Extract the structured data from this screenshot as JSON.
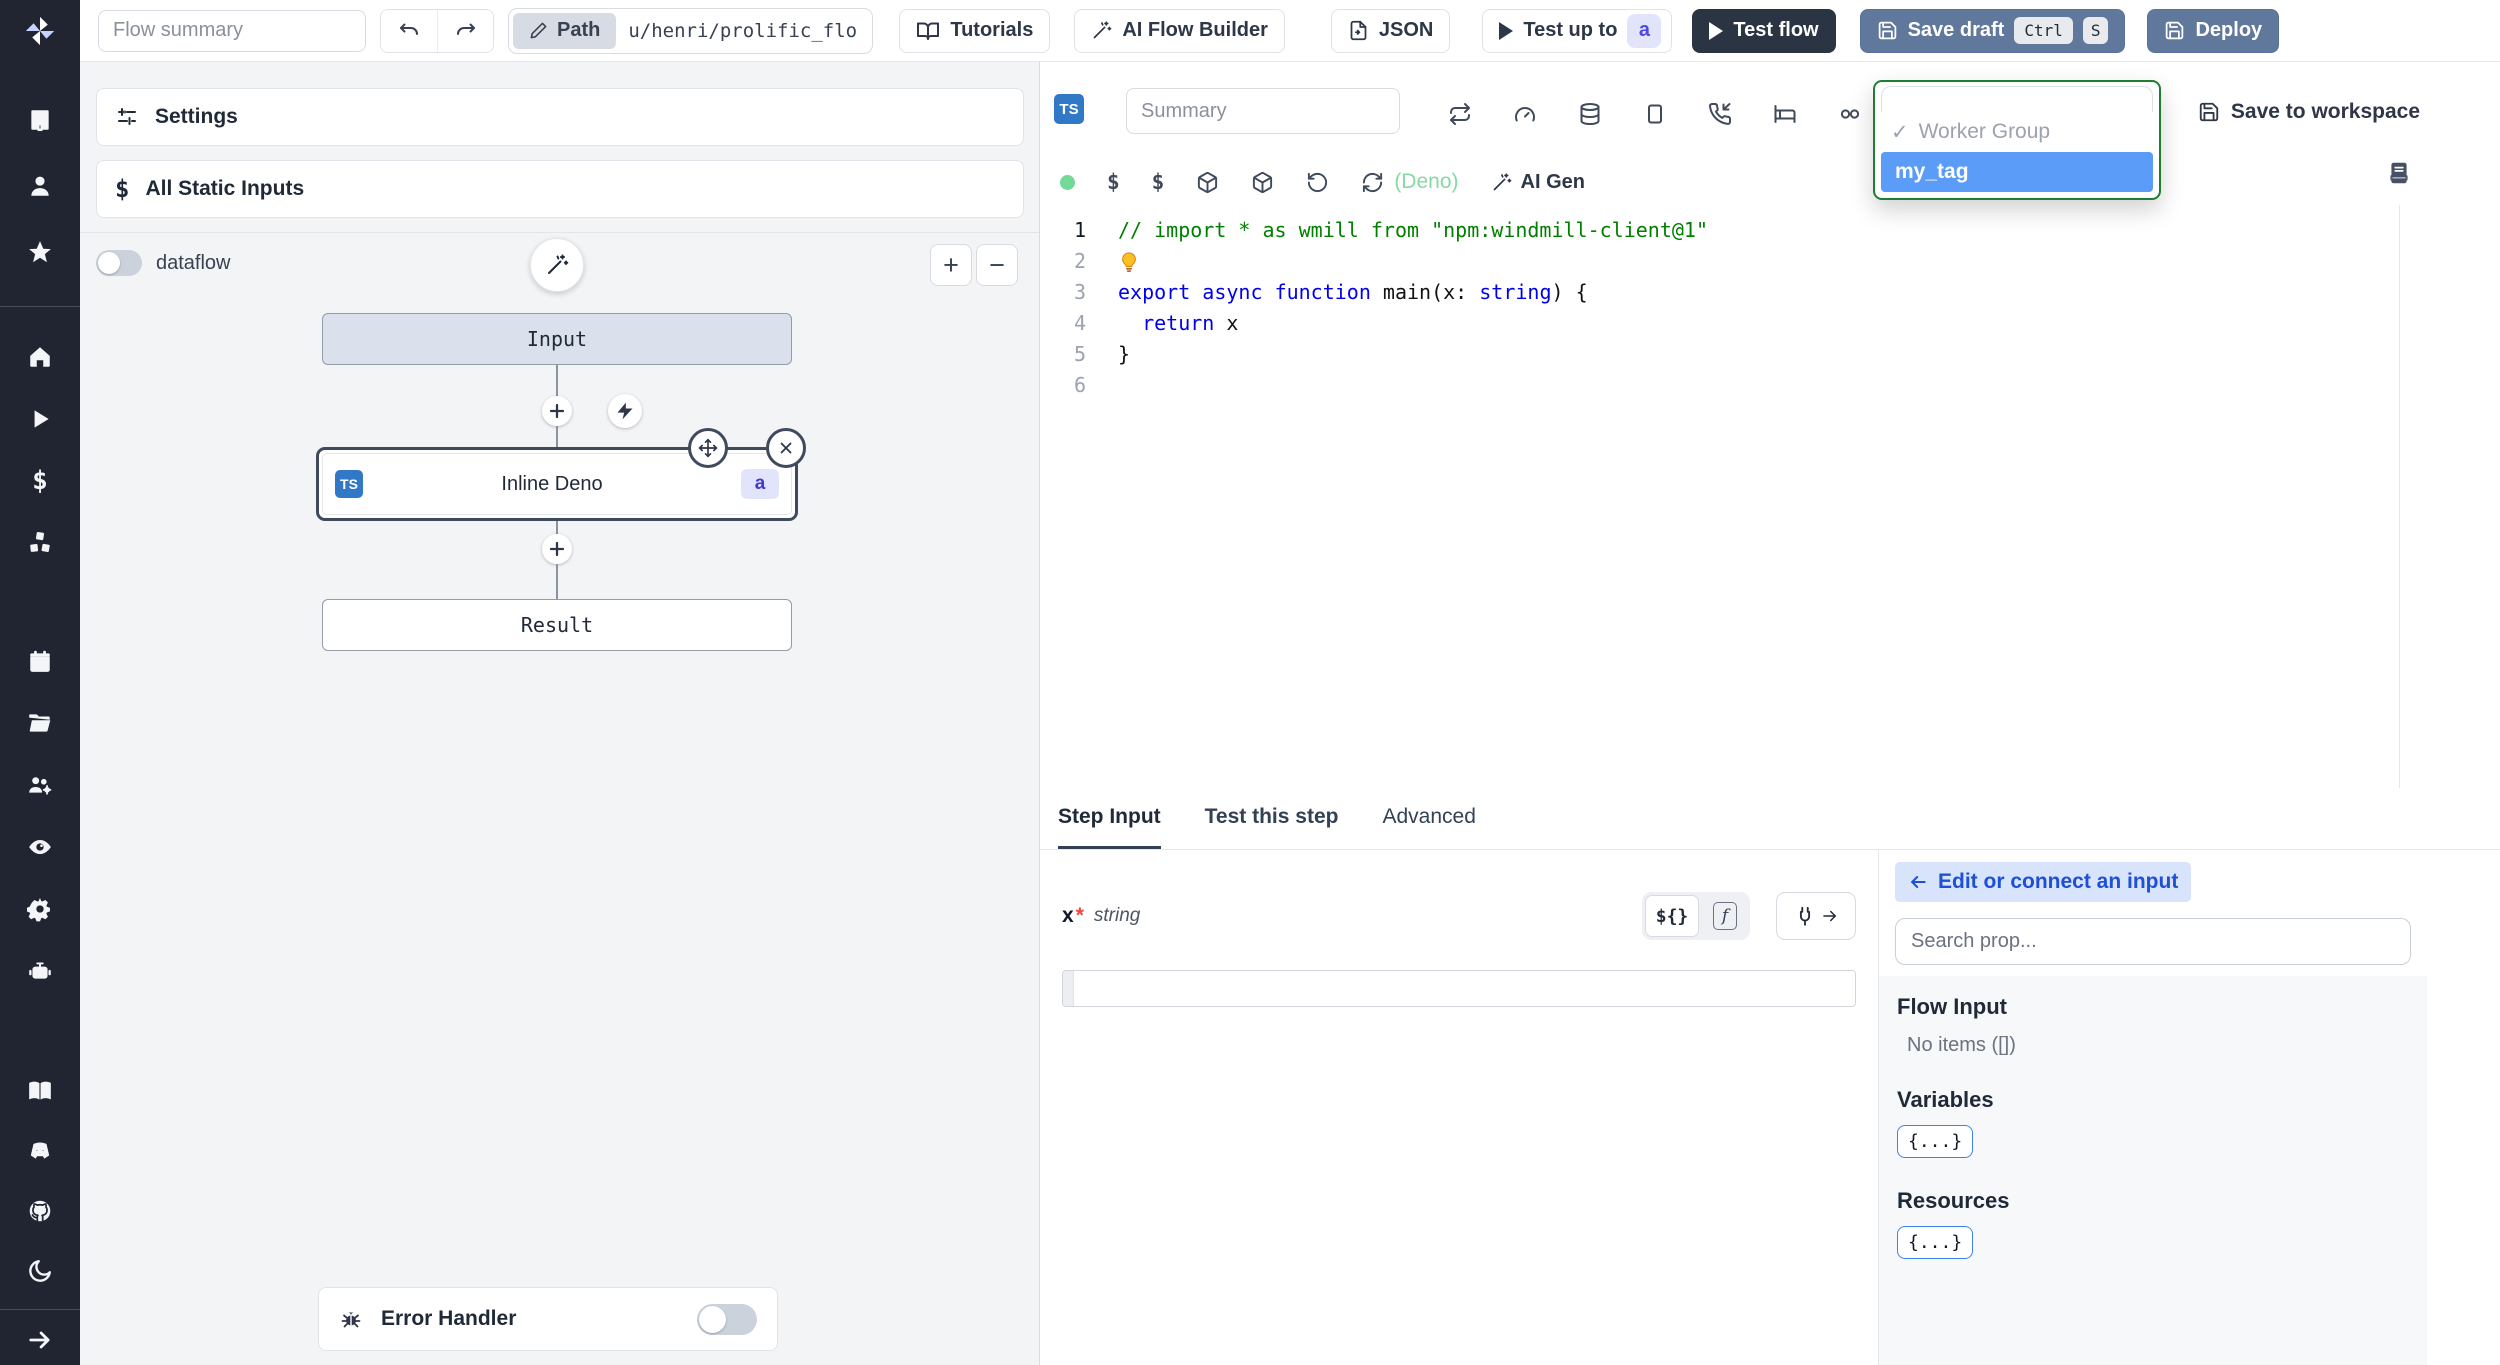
{
  "topbar": {
    "flow_summary_placeholder": "Flow summary",
    "path_label": "Path",
    "path_value": "u/henri/prolific_flow",
    "tutorials": "Tutorials",
    "ai_flow_builder": "AI Flow Builder",
    "json": "JSON",
    "test_up_to": "Test up to",
    "test_up_to_badge": "a",
    "test_flow": "Test flow",
    "save_draft": "Save draft",
    "kbd_ctrl": "Ctrl",
    "kbd_s": "S",
    "deploy": "Deploy"
  },
  "flow_panel": {
    "settings": "Settings",
    "all_static_inputs": "All Static Inputs",
    "dataflow": "dataflow",
    "zoom_in": "+",
    "zoom_out": "−",
    "input_node": "Input",
    "step_node": {
      "lang": "TS",
      "label": "Inline Deno",
      "id": "a"
    },
    "result_node": "Result",
    "error_handler": "Error Handler"
  },
  "editor": {
    "lang": "TS",
    "summary_placeholder": "Summary",
    "dollar1": "$",
    "dollar2": "$",
    "deno_label": "(Deno)",
    "ai_gen": "AI Gen",
    "worker_group": {
      "check": "✓",
      "label": "Worker Group",
      "selected": "my_tag"
    },
    "save_to_workspace": "Save to workspace"
  },
  "code": {
    "active_line": 1,
    "lines": [
      {
        "num": 1,
        "tokens": [
          {
            "t": "// import * as wmill from \"npm:windmill-client@1\"",
            "c": "comment"
          }
        ]
      },
      {
        "num": 2,
        "tokens": [
          {
            "t": "",
            "c": "bulb"
          }
        ]
      },
      {
        "num": 3,
        "tokens": [
          {
            "t": "export",
            "c": "kw"
          },
          {
            "t": " ",
            "c": "p"
          },
          {
            "t": "async",
            "c": "kw"
          },
          {
            "t": " ",
            "c": "p"
          },
          {
            "t": "function",
            "c": "kw"
          },
          {
            "t": " main(x: ",
            "c": "p"
          },
          {
            "t": "string",
            "c": "kw"
          },
          {
            "t": ") {",
            "c": "p"
          }
        ]
      },
      {
        "num": 4,
        "tokens": [
          {
            "t": "  ",
            "c": "p"
          },
          {
            "t": "return",
            "c": "kw"
          },
          {
            "t": " x",
            "c": "p"
          }
        ]
      },
      {
        "num": 5,
        "tokens": [
          {
            "t": "}",
            "c": "p"
          }
        ]
      },
      {
        "num": 6,
        "tokens": []
      }
    ]
  },
  "bottom": {
    "tabs": [
      {
        "label": "Step Input"
      },
      {
        "label": "Test this step"
      },
      {
        "label": "Advanced"
      }
    ],
    "active_tab": 0,
    "form": {
      "field": "x",
      "required": "*",
      "type": "string",
      "value": "",
      "template_btn": "${}",
      "fn_btn": "f"
    },
    "props": {
      "edit_connect": "Edit or connect an input",
      "search_placeholder": "Search prop...",
      "flow_input_title": "Flow Input",
      "flow_input_empty": "No items ([])",
      "variables_title": "Variables",
      "variables_chip": "{...}",
      "resources_title": "Resources",
      "resources_chip": "{...}"
    }
  },
  "colors": {
    "sidebar_bg": "#202531",
    "accent_blue": "#5b9cf8",
    "selected_green": "#1e7e34",
    "slate_button": "#61789d",
    "dark_button": "#2b3442",
    "ts_blue": "#3178c6",
    "badge_bg": "#e2e4fc",
    "badge_text": "#4f46e5",
    "status_green": "#72d996"
  }
}
